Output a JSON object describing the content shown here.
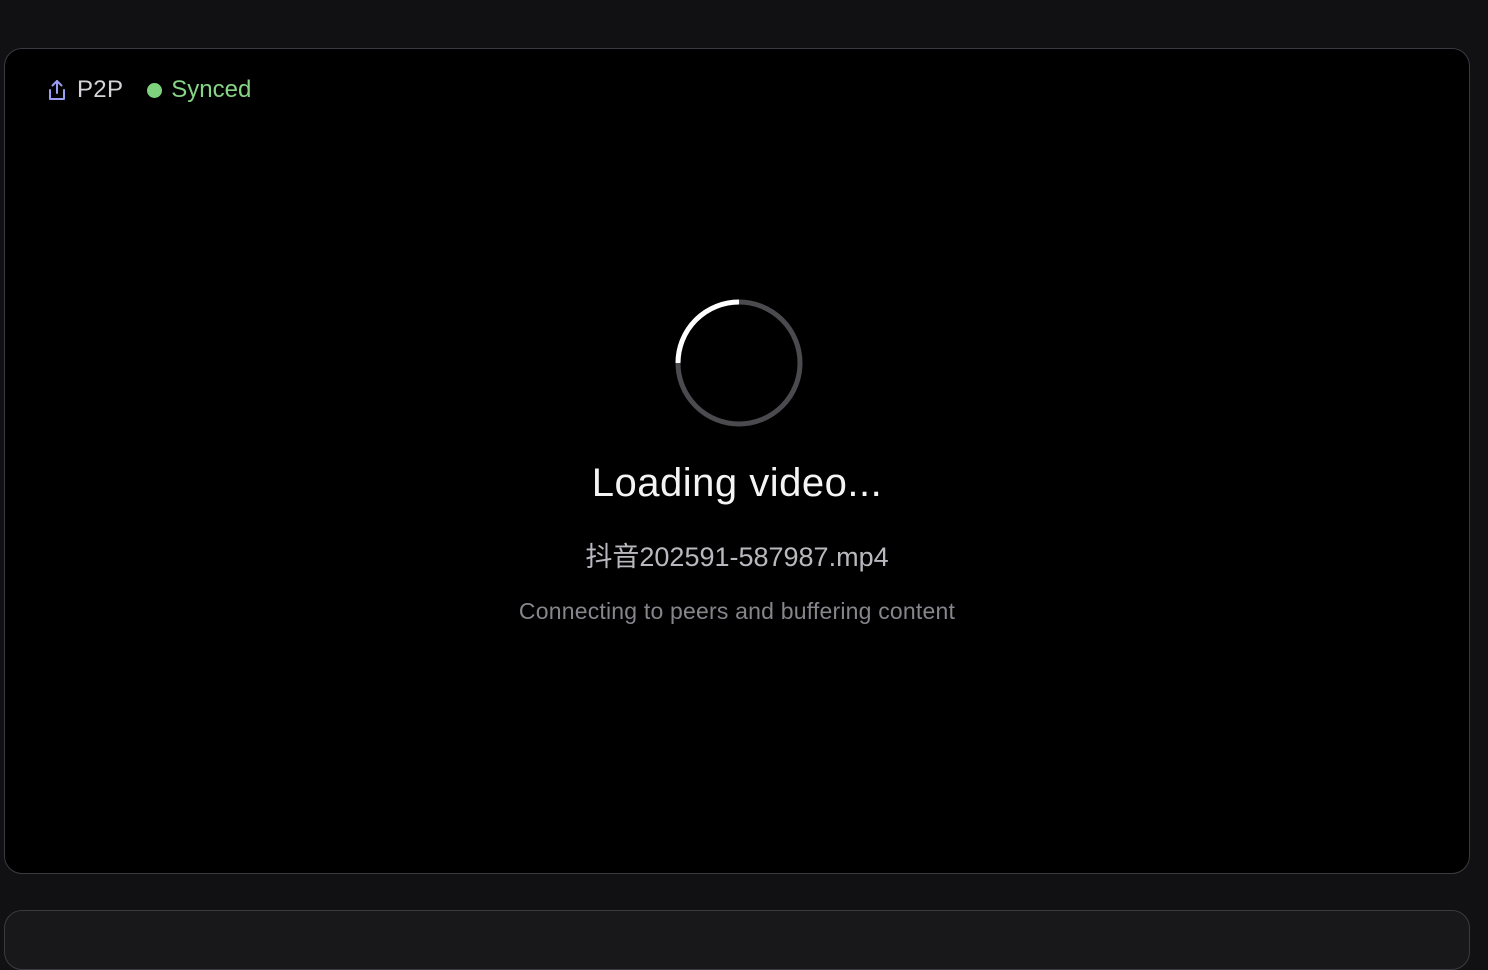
{
  "status": {
    "p2p_label": "P2P",
    "p2p_icon": "share-upload-icon",
    "sync_label": "Synced",
    "sync_color": "#86d486"
  },
  "loader": {
    "title": "Loading video...",
    "file_name": "抖音202591-587987.mp4",
    "message": "Connecting to peers and buffering content",
    "spinner_icon": "loading-spinner-icon"
  },
  "colors": {
    "background": "#111114",
    "player_background": "#000000",
    "accent_icon": "#8b8ff0"
  }
}
